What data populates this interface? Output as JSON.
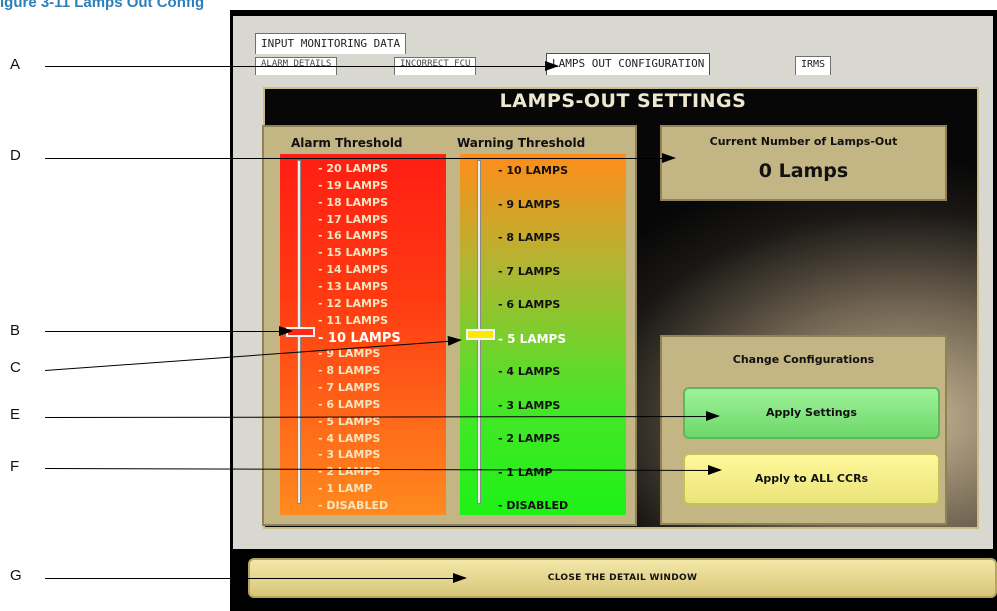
{
  "figure": {
    "title": "igure 3-11 Lamps Out Config"
  },
  "callouts": [
    "A",
    "B",
    "C",
    "D",
    "E",
    "F",
    "G"
  ],
  "tabs": {
    "row1": [
      "INPUT MONITORING DATA"
    ],
    "row2": [
      "ALARM DETAILS",
      "INCORRECT FCU",
      "LAMPS OUT CONFIGURATION",
      "IRMS"
    ],
    "active": "LAMPS OUT CONFIGURATION"
  },
  "panel": {
    "title": "LAMPS-OUT SETTINGS"
  },
  "alarm": {
    "header": "Alarm Threshold",
    "levels": [
      "20 LAMPS",
      "19 LAMPS",
      "18 LAMPS",
      "17 LAMPS",
      "16 LAMPS",
      "15 LAMPS",
      "14 LAMPS",
      "13 LAMPS",
      "12 LAMPS",
      "11 LAMPS",
      "10 LAMPS",
      "9 LAMPS",
      "8 LAMPS",
      "7 LAMPS",
      "6 LAMPS",
      "5 LAMPS",
      "4 LAMPS",
      "3 LAMPS",
      "2 LAMPS",
      "1 LAMP",
      "DISABLED"
    ],
    "selected": "10 LAMPS",
    "slider_color": "#ff2a1a"
  },
  "warning": {
    "header": "Warning Threshold",
    "levels": [
      "10 LAMPS",
      "9 LAMPS",
      "8 LAMPS",
      "7 LAMPS",
      "6 LAMPS",
      "5 LAMPS",
      "4 LAMPS",
      "3 LAMPS",
      "2 LAMPS",
      "1 LAMP",
      "DISABLED"
    ],
    "selected": "5 LAMPS",
    "slider_color": "#ffe800"
  },
  "current": {
    "label": "Current Number of Lamps-Out",
    "value": "0 Lamps"
  },
  "change": {
    "label": "Change Configurations",
    "apply_settings": "Apply Settings",
    "apply_all": "Apply to ALL CCRs"
  },
  "close_button": "CLOSE THE DETAIL WINDOW"
}
